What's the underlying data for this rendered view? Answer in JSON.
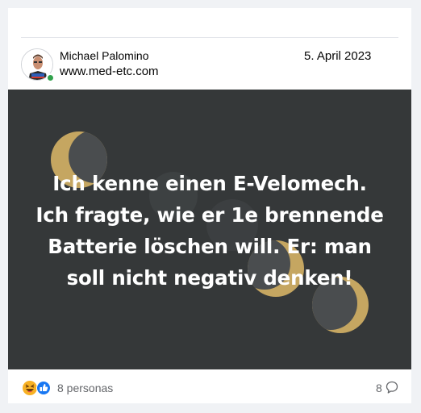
{
  "post": {
    "author": "Michael Palomino",
    "website": "www.med-etc.com",
    "date": "5. April 2023",
    "text_lines": [
      "Ich kenne einen E-Velomech.",
      "Ich fragte, wie er 1e brennende",
      "Batterie löschen will. Er: man",
      "soll nicht negativ denken!"
    ],
    "background_color": "#353839",
    "accent_color": "#c5a661"
  },
  "footer": {
    "reactions_label": "8 personas",
    "reaction_icons": [
      "haha-icon",
      "like-icon"
    ],
    "comment_count": "8",
    "comment_icon": "comment-icon"
  }
}
